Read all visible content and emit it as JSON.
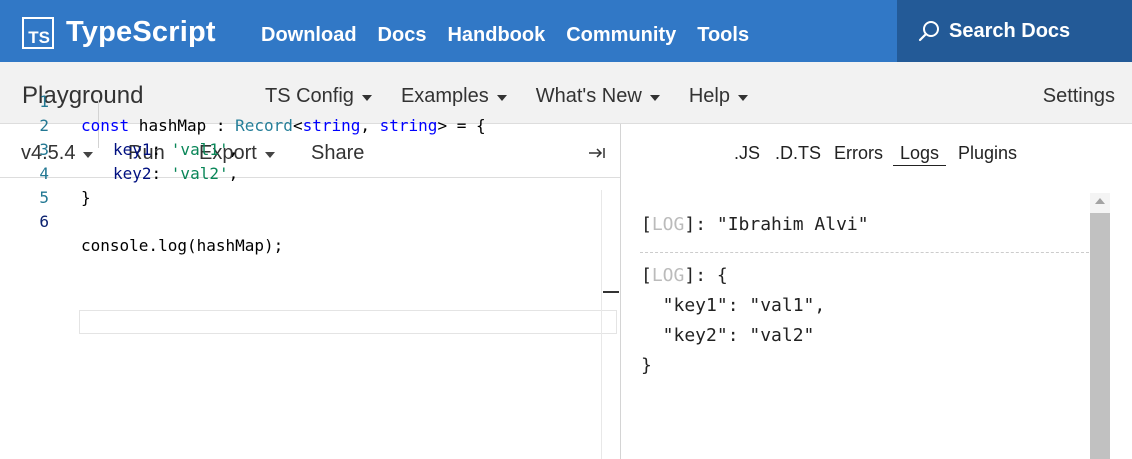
{
  "nav": {
    "logo_text": "TS",
    "brand": "TypeScript",
    "links": [
      "Download",
      "Docs",
      "Handbook",
      "Community",
      "Tools"
    ],
    "search_label": "Search Docs"
  },
  "playground": {
    "title": "Playground",
    "menus": [
      "TS Config",
      "Examples",
      "What's New",
      "Help"
    ],
    "settings": "Settings"
  },
  "editor": {
    "version": "v4.5.4",
    "run": "Run",
    "export": "Export",
    "share": "Share",
    "line_numbers": [
      "1",
      "2",
      "3",
      "4",
      "5",
      "6"
    ],
    "code": {
      "l1": {
        "kw": "const",
        "name": " hashMap",
        "colon": " : ",
        "type": "Record",
        "lt": "<",
        "t1": "string",
        "comma": ", ",
        "t2": "string",
        "rest": "> = {"
      },
      "l2": {
        "key": "key1",
        "colon": ": ",
        "val": "'val1'",
        "end": ","
      },
      "l3": {
        "key": "key2",
        "colon": ": ",
        "val": "'val2'",
        "end": ","
      },
      "l4": "}",
      "l6": "console.log(hashMap);"
    }
  },
  "output": {
    "tabs": [
      ".JS",
      ".D.TS",
      "Errors",
      "Logs",
      "Plugins"
    ],
    "active_tab": "Logs",
    "log1": {
      "open": "[",
      "tag": "LOG",
      "close": "]: ",
      "value": "\"Ibrahim Alvi\""
    },
    "log2": {
      "open": "[",
      "tag": "LOG",
      "close": "]: {",
      "line1": "  \"key1\": \"val1\",",
      "line2": "  \"key2\": \"val2\"",
      "line3": "}"
    }
  },
  "colors": {
    "nav_bg": "#3178c6",
    "search_bg": "#235a97",
    "bar_bg": "#f2f2f2"
  }
}
